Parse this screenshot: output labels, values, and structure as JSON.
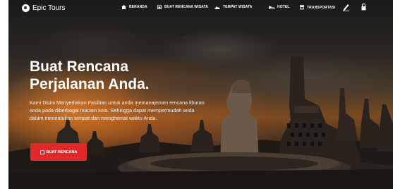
{
  "brand": {
    "name": "Epic Tours",
    "logo_icon": "compass-icon"
  },
  "nav": {
    "items": [
      {
        "label": "BERANDA",
        "icon": "home-icon"
      },
      {
        "label": "BUAT RENCANA WISATA",
        "icon": "calendar-icon"
      },
      {
        "label": "TEMPAT WISATA",
        "icon": "mountain-icon"
      },
      {
        "label": "HOTEL",
        "icon": "bed-icon"
      },
      {
        "label": "TRANSPORTASI",
        "icon": "bus-icon"
      }
    ],
    "edit_icon": "pencil-icon",
    "account_icon": "lock-icon"
  },
  "hero": {
    "title_line1": "Buat Rencana",
    "title_line2": "Perjalanan Anda.",
    "description": "Kami Disini Menyediakan Fasilitas untuk anda memanajemen rencana liburan anda pada diberbagai macam kota. Sehingga dapat mempermudah anda dalam menentukan tempat dan menghemat waktu Anda.",
    "cta_label": "BUAT RENCANA",
    "cta_icon": "edit-icon"
  },
  "colors": {
    "accent": "#e02a2a",
    "text": "#ffffff"
  }
}
